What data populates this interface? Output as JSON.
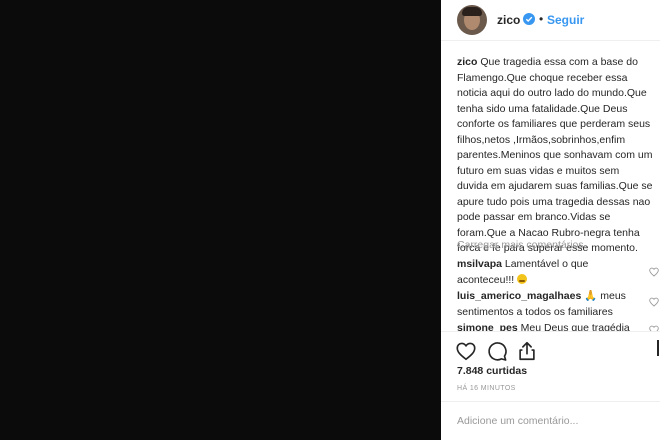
{
  "post": {
    "username": "zico",
    "follow_label": "Seguir",
    "dot": "•",
    "caption_user": "zico",
    "caption_text": " Que tragedia essa com a base do Flamengo.Que choque receber essa noticia aqui do outro lado do mundo.Que tenha sido uma fatalidade.Que Deus conforte os familiares que perderam seus filhos,netos ,Irmãos,sobrinhos,enfim parentes.Meninos que sonhavam com um futuro em suas vidas e muitos sem duvida em ajudarem suas familias.Que se apure tudo pois uma tragedia dessas nao pode passar em branco.Vidas se foram.Que a Nacao Rubro-negra tenha forca e fe para superar esse momento.",
    "load_more": "Carregar mais comentários",
    "comments": [
      {
        "user": "msilvapa",
        "text": " Lamentável o que aconteceu!!! "
      },
      {
        "user": "luis_americo_magalhaes",
        "text": " 🙏 meus sentimentos a todos os familiares"
      },
      {
        "user": "simone_pes",
        "text": " Meu Deus que tragédia"
      }
    ],
    "likes": "7.848 curtidas",
    "time": "HÁ 16 MINUTOS",
    "add_comment_placeholder": "Adicione um comentário..."
  },
  "colors": {
    "accent": "#3897f0",
    "media_bg": "#0b0b0b",
    "muted": "#999999"
  }
}
